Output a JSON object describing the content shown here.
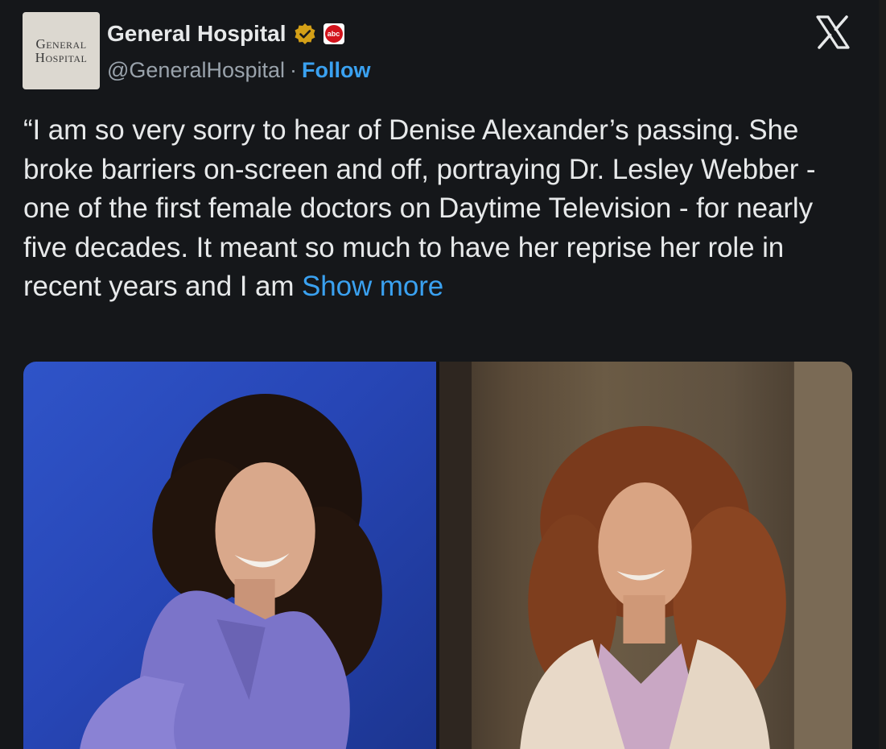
{
  "author": {
    "avatar_line1": "General",
    "avatar_line2": "Hospital",
    "display_name": "General Hospital",
    "handle": "@GeneralHospital",
    "separator": "·",
    "follow_label": "Follow",
    "badge_text": "abc"
  },
  "tweet": {
    "text": "“I am so very sorry to hear of Denise Alexander’s passing. She broke barriers on-screen and off, portraying Dr. Lesley Webber - one of the first female doctors on Daytime Television - for nearly five decades. It meant so much to have her reprise her role in recent years and I am ",
    "show_more_label": "Show more"
  },
  "icons": {
    "verified": "verified-gold-badge-icon",
    "affiliate": "abc-network-logo-icon",
    "platform": "x-logo-icon"
  },
  "colors": {
    "background": "#15171a",
    "text": "#e7e9ea",
    "muted": "#9aa3ac",
    "link": "#3aa1f0",
    "verified_gold": "#d4a017"
  }
}
